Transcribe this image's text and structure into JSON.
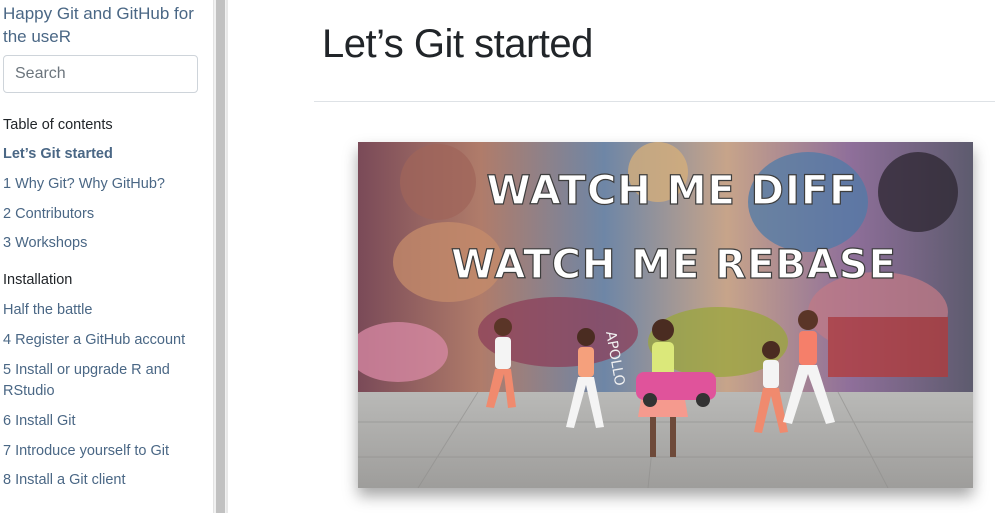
{
  "sidebar": {
    "title": "Happy Git and GitHub for the useR",
    "search_placeholder": "Search",
    "toc_heading": "Table of contents",
    "items": [
      {
        "label": "Let’s Git started",
        "active": true
      },
      {
        "label": "1 Why Git? Why GitHub?"
      },
      {
        "label": "2 Contributors"
      },
      {
        "label": "3 Workshops"
      }
    ],
    "section_installation": "Installation",
    "install_items": [
      {
        "label": "Half the battle"
      },
      {
        "label": "4 Register a GitHub account"
      },
      {
        "label": "5 Install or upgrade R and RStudio"
      },
      {
        "label": "6 Install Git"
      },
      {
        "label": "7 Introduce yourself to Git"
      },
      {
        "label": "8 Install a Git client"
      }
    ]
  },
  "main": {
    "title": "Let’s Git started",
    "hero": {
      "line1": "WATCH ME DIFF",
      "line2": "WATCH ME REBASE",
      "mural_text": "APOLLO"
    }
  },
  "colors": {
    "link": "#4a6785",
    "text": "#212529",
    "border": "#ced4da"
  }
}
